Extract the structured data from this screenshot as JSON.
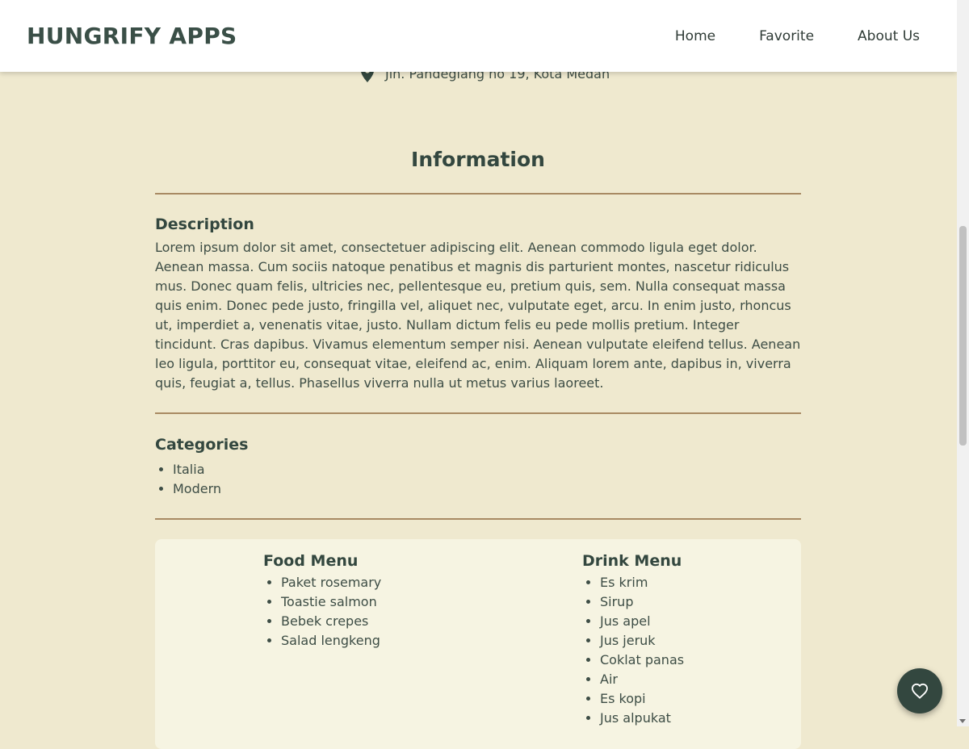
{
  "header": {
    "brand": "HUNGRIFY APPS",
    "nav": [
      "Home",
      "Favorite",
      "About Us"
    ]
  },
  "restaurant": {
    "address": "Jln. Pandeglang no 19, Kota Medan"
  },
  "information": {
    "title": "Information",
    "description_heading": "Description",
    "description": "Lorem ipsum dolor sit amet, consectetuer adipiscing elit. Aenean commodo ligula eget dolor. Aenean massa. Cum sociis natoque penatibus et magnis dis parturient montes, nascetur ridiculus mus. Donec quam felis, ultricies nec, pellentesque eu, pretium quis, sem. Nulla consequat massa quis enim. Donec pede justo, fringilla vel, aliquet nec, vulputate eget, arcu. In enim justo, rhoncus ut, imperdiet a, venenatis vitae, justo. Nullam dictum felis eu pede mollis pretium. Integer tincidunt. Cras dapibus. Vivamus elementum semper nisi. Aenean vulputate eleifend tellus. Aenean leo ligula, porttitor eu, consequat vitae, eleifend ac, enim. Aliquam lorem ante, dapibus in, viverra quis, feugiat a, tellus. Phasellus viverra nulla ut metus varius laoreet.",
    "categories_heading": "Categories",
    "categories": [
      "Italia",
      "Modern"
    ]
  },
  "menus": {
    "food_heading": "Food Menu",
    "food": [
      "Paket rosemary",
      "Toastie salmon",
      "Bebek crepes",
      "Salad lengkeng"
    ],
    "drink_heading": "Drink Menu",
    "drink": [
      "Es krim",
      "Sirup",
      "Jus apel",
      "Jus jeruk",
      "Coklat panas",
      "Air",
      "Es kopi",
      "Jus alpukat"
    ]
  },
  "fab": {
    "icon": "heart-icon"
  },
  "colors": {
    "background": "#efe9cf",
    "header": "#ffffff",
    "brand_text": "#3a4f47",
    "divider": "#a88a63",
    "menu_card": "#f6f4e2",
    "fab": "#33473f"
  }
}
